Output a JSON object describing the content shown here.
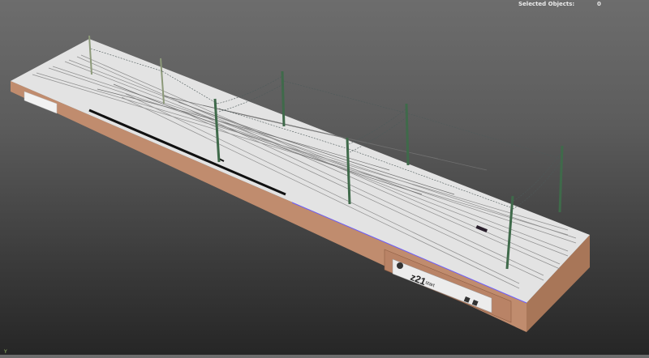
{
  "hud": {
    "selected_objects_label": "Selected Objects:",
    "selected_objects_value": "0"
  },
  "module": {
    "logo_main": "z21",
    "logo_sub": "start"
  },
  "axis_label": "Y",
  "colors": {
    "background_top": "#6d6d6d",
    "background_bottom": "#262626",
    "baseboard_side": "#c08c6e",
    "baseboard_front": "#a87658",
    "top_surface": "#e3e3e3",
    "mast": "#3f6a4a",
    "rail": "#8a8a8a",
    "accent_outline": "#6a5cff"
  }
}
